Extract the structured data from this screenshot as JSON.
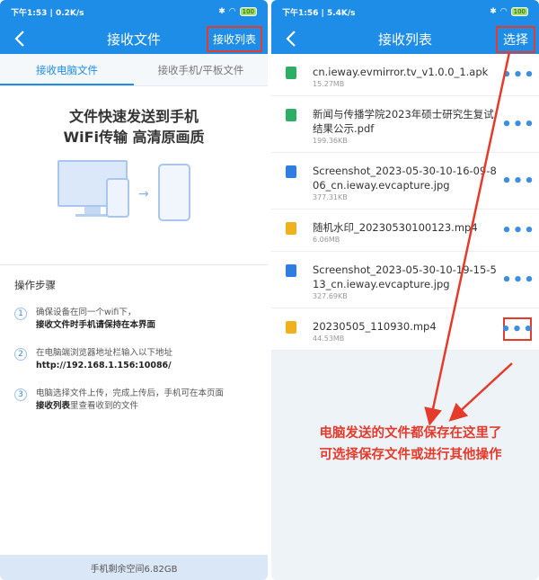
{
  "left": {
    "status": {
      "time_speed": "下午1:53 | 0.2K/s",
      "battery": "100"
    },
    "title": "接收文件",
    "action": "接收列表",
    "tabs": [
      "接收电脑文件",
      "接收手机/平板文件"
    ],
    "hero": {
      "line1": "文件快速发送到手机",
      "line2": "WiFi传输 高清原画质"
    },
    "steps_title": "操作步骤",
    "steps": [
      {
        "num": "1",
        "line1": "确保设备在同一个wifi下，",
        "line2": "接收文件时手机请保持在本界面"
      },
      {
        "num": "2",
        "line1": "在电脑端浏览器地址栏输入以下地址",
        "line2": "http://192.168.1.156:10086/"
      },
      {
        "num": "3",
        "line1": "电脑选择文件上传，完成上传后，手机可在本页面",
        "line2_bold": "接收列表",
        "line2_rest": "里查看收到的文件"
      }
    ],
    "storage": "手机剩余空间6.82GB"
  },
  "right": {
    "status": {
      "time_speed": "下午1:56 | 5.4K/s",
      "battery": "100"
    },
    "title": "接收列表",
    "action": "选择",
    "files": [
      {
        "name": "cn.ieway.evmirror.tv_v1.0.0_1.apk",
        "size": "15.27MB",
        "type": "apk"
      },
      {
        "name": "新闻与传播学院2023年硕士研究生复试结果公示.pdf",
        "size": "199.36KB",
        "type": "pdf"
      },
      {
        "name": "Screenshot_2023-05-30-10-16-09-806_cn.ieway.evcapture.jpg",
        "size": "377.31KB",
        "type": "img"
      },
      {
        "name": "随机水印_20230530100123.mp4",
        "size": "6.06MB",
        "type": "vid"
      },
      {
        "name": "Screenshot_2023-05-30-10-19-15-513_cn.ieway.evcapture.jpg",
        "size": "327.69KB",
        "type": "img"
      },
      {
        "name": "20230505_110930.mp4",
        "size": "44.53MB",
        "type": "vid"
      }
    ],
    "more_glyph": "•••",
    "annotation": {
      "line1": "电脑发送的文件都保存在这里了",
      "line2": "可选择保存文件或进行其他操作"
    }
  },
  "colors": {
    "primary": "#1e8de8",
    "highlight": "#e63a2b"
  },
  "icons": {
    "back": "chevron-left-icon",
    "more": "more-dots-icon"
  }
}
